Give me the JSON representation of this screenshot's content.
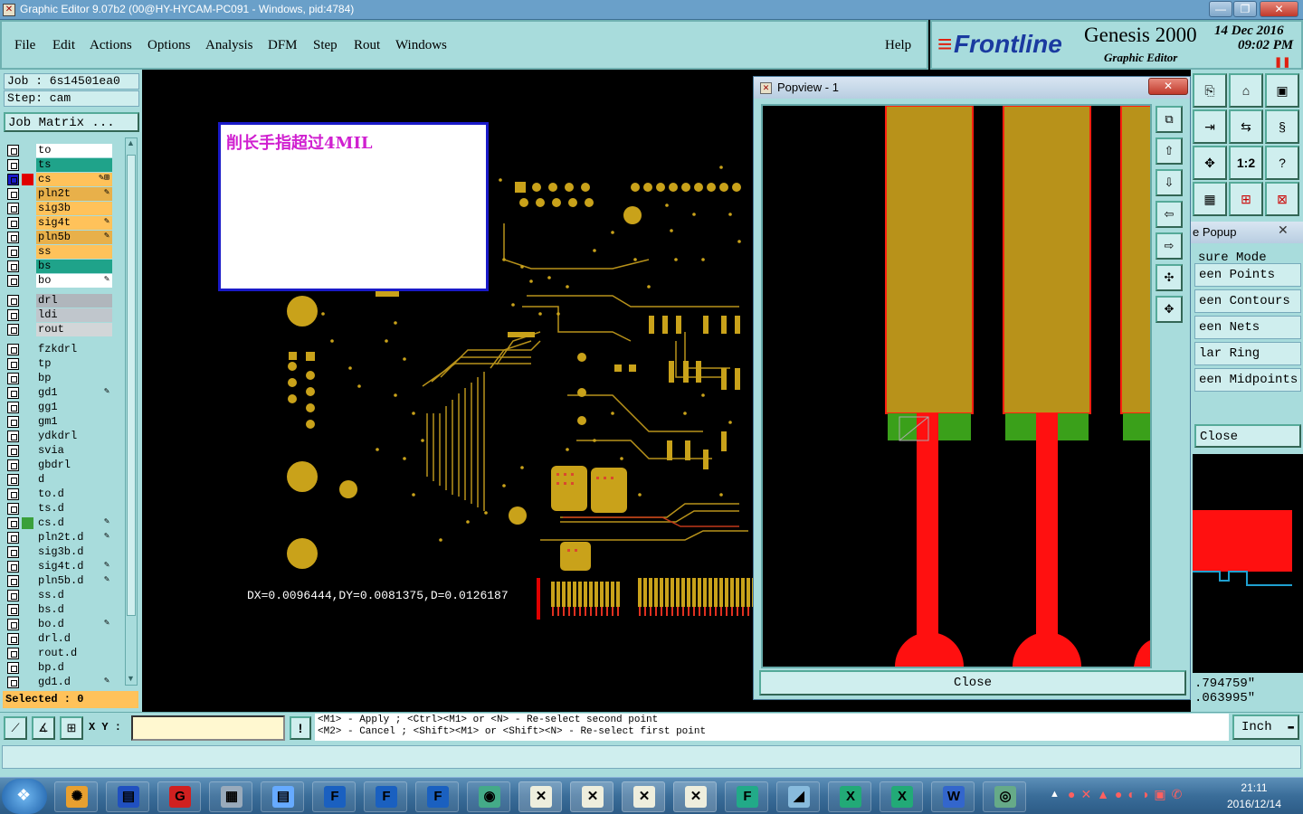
{
  "window": {
    "title": "Graphic Editor 9.07b2 (00@HY-HYCAM-PC091 - Windows, pid:4784)",
    "min_label": "—",
    "max_label": "❐",
    "close_label": "✕"
  },
  "menu": {
    "items": [
      "File",
      "Edit",
      "Actions",
      "Options",
      "Analysis",
      "DFM",
      "Step",
      "Rout",
      "Windows"
    ],
    "help": "Help"
  },
  "brand": {
    "logo": "Frontline",
    "product": "Genesis 2000",
    "subtitle": "Graphic Editor",
    "date": "14 Dec 2016",
    "time": "09:02 PM"
  },
  "job": {
    "job_label": "Job : 6s14501ea0",
    "step_label": "Step: cam",
    "matrix_button": "Job Matrix ..."
  },
  "layers": [
    {
      "name": "to",
      "color": "#ffffff",
      "mark": ""
    },
    {
      "name": "ts",
      "color": "#1fa38a",
      "mark": ""
    },
    {
      "name": "cs",
      "color": "#ffc25a",
      "mark": "✎⊞",
      "swatch": "#e00000",
      "selected": true
    },
    {
      "name": "pln2t",
      "color": "#e8b04a",
      "mark": "✎"
    },
    {
      "name": "sig3b",
      "color": "#ffc25a",
      "mark": ""
    },
    {
      "name": "sig4t",
      "color": "#ffc25a",
      "mark": "✎"
    },
    {
      "name": "pln5b",
      "color": "#e8b04a",
      "mark": "✎"
    },
    {
      "name": "ss",
      "color": "#ffc25a",
      "mark": ""
    },
    {
      "name": "bs",
      "color": "#1fa38a",
      "mark": ""
    },
    {
      "name": "bo",
      "color": "#ffffff",
      "mark": "✎"
    },
    {
      "name": "drl",
      "color": "#b0b6bc",
      "mark": ""
    },
    {
      "name": "ldi",
      "color": "#c0c6cc",
      "mark": ""
    },
    {
      "name": "rout",
      "color": "#d2d6d8",
      "mark": ""
    },
    {
      "name": "fzkdrl",
      "color": "#a8dcdc",
      "mark": ""
    },
    {
      "name": "tp",
      "color": "#a8dcdc",
      "mark": ""
    },
    {
      "name": "bp",
      "color": "#a8dcdc",
      "mark": ""
    },
    {
      "name": "gd1",
      "color": "#a8dcdc",
      "mark": "✎"
    },
    {
      "name": "gg1",
      "color": "#a8dcdc",
      "mark": ""
    },
    {
      "name": "gm1",
      "color": "#a8dcdc",
      "mark": ""
    },
    {
      "name": "ydkdrl",
      "color": "#a8dcdc",
      "mark": ""
    },
    {
      "name": "svia",
      "color": "#a8dcdc",
      "mark": ""
    },
    {
      "name": "gbdrl",
      "color": "#a8dcdc",
      "mark": ""
    },
    {
      "name": "d",
      "color": "#a8dcdc",
      "mark": ""
    },
    {
      "name": "to.d",
      "color": "#a8dcdc",
      "mark": ""
    },
    {
      "name": "ts.d",
      "color": "#a8dcdc",
      "mark": ""
    },
    {
      "name": "cs.d",
      "color": "#a8dcdc",
      "mark": "✎",
      "swatch": "#3aa03a"
    },
    {
      "name": "pln2t.d",
      "color": "#a8dcdc",
      "mark": "✎"
    },
    {
      "name": "sig3b.d",
      "color": "#a8dcdc",
      "mark": ""
    },
    {
      "name": "sig4t.d",
      "color": "#a8dcdc",
      "mark": "✎"
    },
    {
      "name": "pln5b.d",
      "color": "#a8dcdc",
      "mark": "✎"
    },
    {
      "name": "ss.d",
      "color": "#a8dcdc",
      "mark": ""
    },
    {
      "name": "bs.d",
      "color": "#a8dcdc",
      "mark": ""
    },
    {
      "name": "bo.d",
      "color": "#a8dcdc",
      "mark": "✎"
    },
    {
      "name": "drl.d",
      "color": "#a8dcdc",
      "mark": ""
    },
    {
      "name": "rout.d",
      "color": "#a8dcdc",
      "mark": ""
    },
    {
      "name": "bp.d",
      "color": "#a8dcdc",
      "mark": ""
    },
    {
      "name": "gd1.d",
      "color": "#a8dcdc",
      "mark": "✎"
    }
  ],
  "selected_label": "Selected : 0",
  "canvas": {
    "note": "削长手指超过4MIL",
    "measurement": "DX=0.0096444,DY=0.0081375,D=0.0126187"
  },
  "popview": {
    "title": "Popview - 1",
    "close_label": "Close"
  },
  "measure_popup": {
    "title": "e Popup",
    "items": [
      "sure Mode",
      "een Points",
      "een Contours",
      "een Nets",
      "lar Ring",
      "een Midpoints"
    ],
    "close_label": "Close",
    "readout_x": ".794759\"",
    "readout_y": ".063995\""
  },
  "tool_buttons": [
    "one-to-two"
  ],
  "tool_button_label": "1:2",
  "statusbar": {
    "xy_label": "X Y :",
    "xy_value": "",
    "hint_line1": "<M1> - Apply  ; <Ctrl><M1> or <N> - Re-select second point",
    "hint_line2": "<M2> - Cancel ; <Shift><M1> or <Shift><N> - Re-select first point",
    "units": "Inch"
  },
  "clock": {
    "time": "21:11",
    "date": "2016/12/14"
  }
}
